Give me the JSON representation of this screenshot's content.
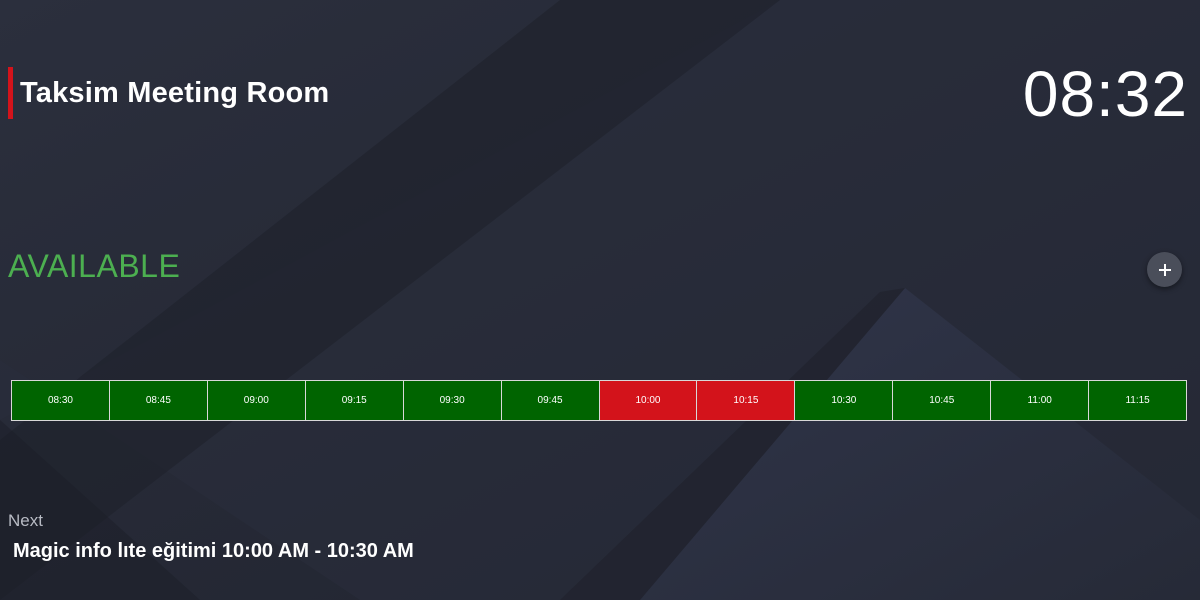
{
  "room": {
    "title": "Taksim Meeting Room",
    "accent_color": "#d3131b"
  },
  "clock": {
    "time": "08:32"
  },
  "status": {
    "text": "AVAILABLE",
    "color": "#4caf50"
  },
  "actions": {
    "add_icon": "plus-icon"
  },
  "timeline": {
    "slots": [
      {
        "time": "08:30",
        "state": "free"
      },
      {
        "time": "08:45",
        "state": "free"
      },
      {
        "time": "09:00",
        "state": "free"
      },
      {
        "time": "09:15",
        "state": "free"
      },
      {
        "time": "09:30",
        "state": "free"
      },
      {
        "time": "09:45",
        "state": "free"
      },
      {
        "time": "10:00",
        "state": "booked"
      },
      {
        "time": "10:15",
        "state": "booked"
      },
      {
        "time": "10:30",
        "state": "free"
      },
      {
        "time": "10:45",
        "state": "free"
      },
      {
        "time": "11:00",
        "state": "free"
      },
      {
        "time": "11:15",
        "state": "free"
      }
    ],
    "colors": {
      "free": "#006400",
      "booked": "#d3131b"
    }
  },
  "next": {
    "label": "Next",
    "meeting": "Magic info lıte eğitimi 10:00 AM - 10:30 AM"
  }
}
